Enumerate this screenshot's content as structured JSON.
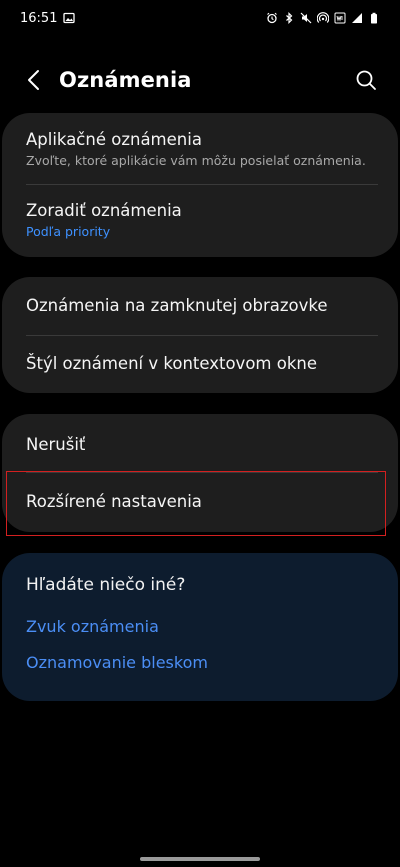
{
  "status_bar": {
    "time": "16:51",
    "left_icons": [
      "gallery-icon"
    ],
    "right_icons": [
      "alarm-icon",
      "bluetooth-icon",
      "mute-icon",
      "hotspot-icon",
      "wifi-calling-icon",
      "signal-icon",
      "battery-icon"
    ]
  },
  "header": {
    "title": "Oznámenia"
  },
  "sections": [
    {
      "items": [
        {
          "title": "Aplikačné oznámenia",
          "subtitle": "Zvoľte, ktoré aplikácie vám môžu posielať oznámenia."
        },
        {
          "title": "Zoradiť oznámenia",
          "subtitle": "Podľa priority"
        }
      ]
    },
    {
      "items": [
        {
          "title": "Oznámenia na zamknutej obrazovke"
        },
        {
          "title": "Štýl oznámení v kontextovom okne"
        }
      ]
    },
    {
      "items": [
        {
          "title": "Nerušiť"
        },
        {
          "title": "Rozšírené nastavenia"
        }
      ]
    }
  ],
  "help_card": {
    "title": "Hľadáte niečo iné?",
    "links": [
      "Zvuk oznámenia",
      "Oznamovanie bleskom"
    ]
  },
  "colors": {
    "background": "#000000",
    "card": "#1e1e1e",
    "help_card": "#0d1c2e",
    "accent": "#3e91ff",
    "highlight": "#d32020"
  }
}
